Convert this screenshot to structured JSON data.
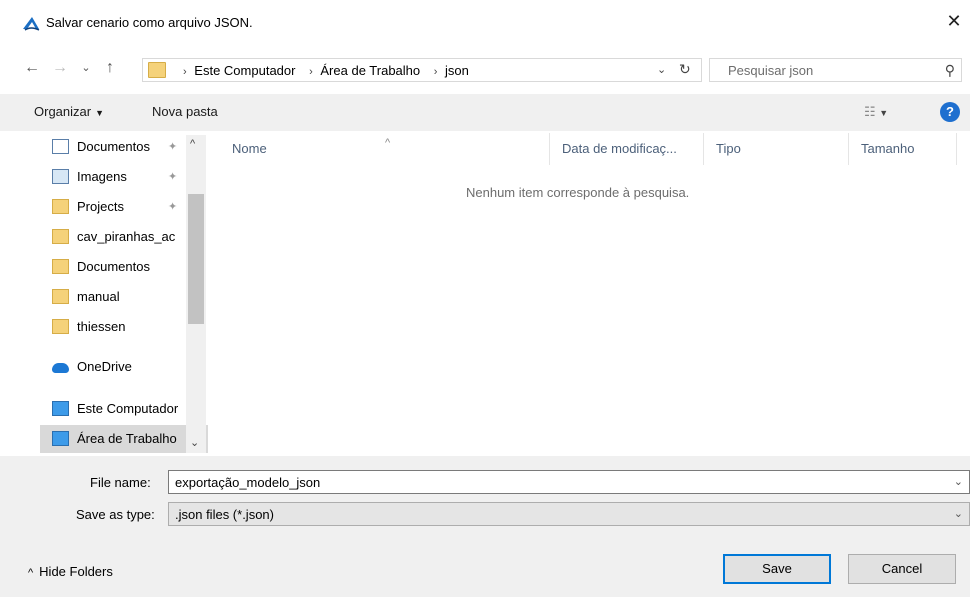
{
  "window": {
    "title": "Salvar cenario como arquivo JSON.",
    "close_glyph": "✕"
  },
  "nav": {
    "back_glyph": "←",
    "forward_glyph": "→",
    "recent_glyph": "⌄",
    "up_glyph": "↑",
    "breadcrumbs": [
      "Este Computador",
      "Área de Trabalho",
      "json"
    ],
    "refresh_glyph": "↻",
    "search_placeholder": "Pesquisar json"
  },
  "toolbar": {
    "organize_label": "Organizar",
    "new_folder_label": "Nova pasta",
    "help_label": "?"
  },
  "sidebar": {
    "items": [
      {
        "label": "Documentos",
        "icon": "document-icon",
        "pinned": true
      },
      {
        "label": "Imagens",
        "icon": "pictures-icon",
        "pinned": true
      },
      {
        "label": "Projects",
        "icon": "folder-icon",
        "pinned": true
      },
      {
        "label": "cav_piranhas_ac",
        "icon": "folder-icon",
        "pinned": false
      },
      {
        "label": "Documentos",
        "icon": "folder-icon",
        "pinned": false
      },
      {
        "label": "manual",
        "icon": "folder-icon",
        "pinned": false
      },
      {
        "label": "thiessen",
        "icon": "folder-icon",
        "pinned": false
      },
      {
        "label": "OneDrive",
        "icon": "onedrive-icon",
        "pinned": false
      },
      {
        "label": "Este Computador",
        "icon": "computer-icon",
        "pinned": false
      },
      {
        "label": "Área de Trabalho",
        "icon": "desktop-icon",
        "pinned": false,
        "selected": true
      }
    ]
  },
  "file_list": {
    "columns": [
      "Nome",
      "Data de modificaç...",
      "Tipo",
      "Tamanho"
    ],
    "empty_message": "Nenhum item corresponde à pesquisa."
  },
  "form": {
    "file_name_label": "File name:",
    "file_name_value": "exportação_modelo_json",
    "save_type_label": "Save as type:",
    "save_type_value": ".json files (*.json)"
  },
  "footer": {
    "hide_folders_label": "Hide Folders",
    "save_label": "Save",
    "cancel_label": "Cancel"
  },
  "colors": {
    "accent": "#0078d7",
    "toolbar_bg": "#f0f0f0",
    "selected_bg": "#d9d9d9",
    "help_blue": "#1e6fcf"
  }
}
